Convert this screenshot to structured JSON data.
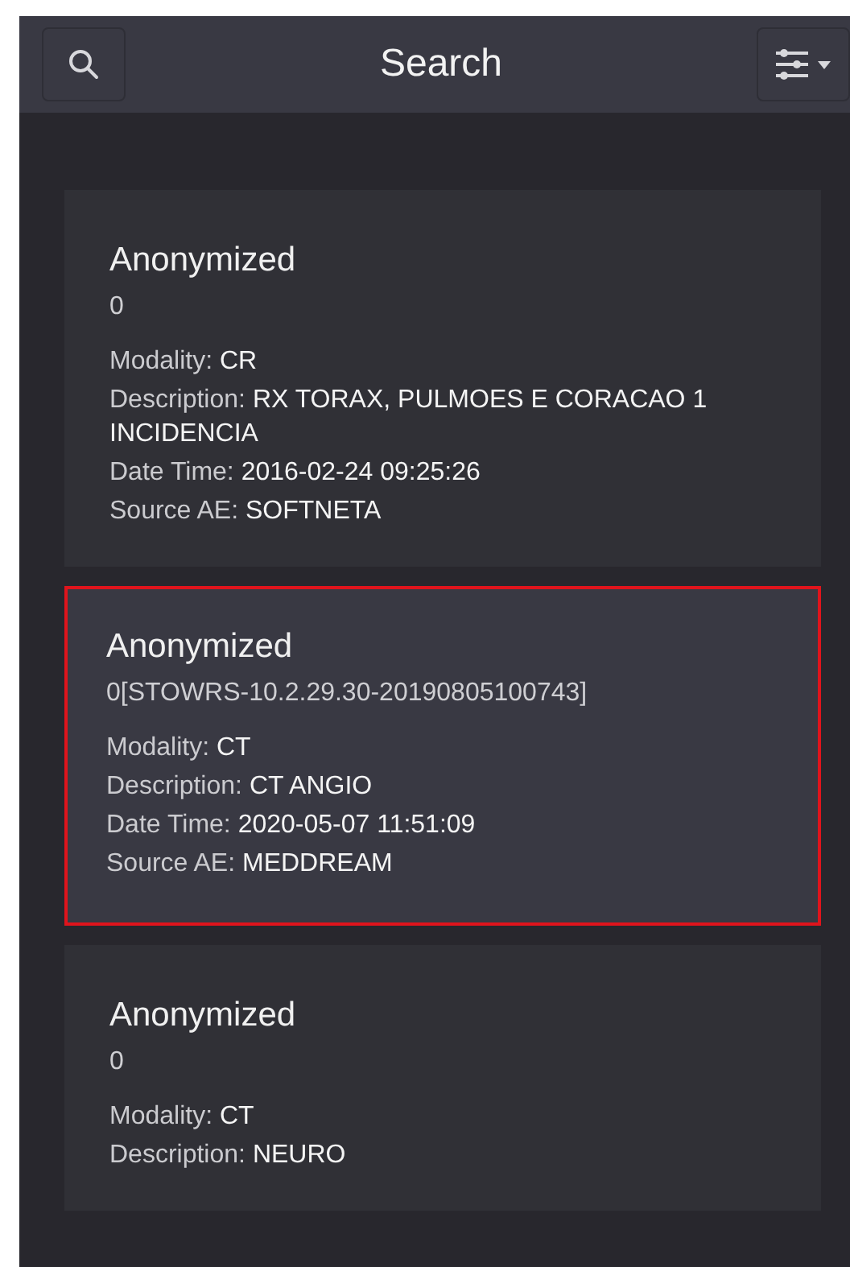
{
  "header": {
    "title": "Search"
  },
  "studies": [
    {
      "title": "Anonymized",
      "subtitle": "0",
      "selected": false,
      "fields": [
        {
          "label": "Modality:",
          "value": "CR"
        },
        {
          "label": "Description:",
          "value": "RX TORAX, PULMOES E CORACAO 1 INCIDENCIA"
        },
        {
          "label": "Date Time:",
          "value": "2016-02-24 09:25:26"
        },
        {
          "label": "Source AE:",
          "value": "SOFTNETA"
        }
      ]
    },
    {
      "title": "Anonymized",
      "subtitle": "0[STOWRS-10.2.29.30-20190805100743]",
      "selected": true,
      "fields": [
        {
          "label": "Modality:",
          "value": "CT"
        },
        {
          "label": "Description:",
          "value": "CT ANGIO"
        },
        {
          "label": "Date Time:",
          "value": "2020-05-07 11:51:09"
        },
        {
          "label": "Source AE:",
          "value": "MEDDREAM"
        }
      ]
    },
    {
      "title": "Anonymized",
      "subtitle": "0",
      "selected": false,
      "fields": [
        {
          "label": "Modality:",
          "value": "CT"
        },
        {
          "label": "Description:",
          "value": "NEURO"
        }
      ]
    }
  ]
}
